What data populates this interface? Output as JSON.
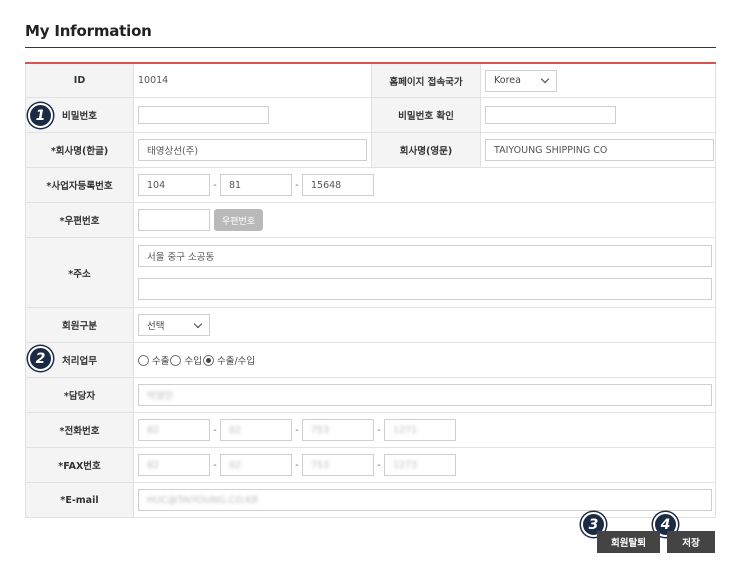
{
  "page": {
    "title": "My Information"
  },
  "form": {
    "id": {
      "label": "ID",
      "value": "10014"
    },
    "country": {
      "label": "홈페이지 접속국가",
      "selected": "Korea"
    },
    "password": {
      "label": "비밀번호",
      "value": ""
    },
    "password_confirm": {
      "label": "비밀번호 확인",
      "value": ""
    },
    "company_kr": {
      "label": "*회사명(한글)",
      "value": "태영상선(주)"
    },
    "company_en": {
      "label": "회사명(영문)",
      "value": "TAIYOUNG SHIPPING CO"
    },
    "business_no": {
      "label": "*사업자등록번호",
      "part1": "104",
      "part2": "81",
      "part3": "15648"
    },
    "postal": {
      "label": "*우편번호",
      "value": "",
      "button": "우편번호"
    },
    "address": {
      "label": "*주소",
      "line1": "서울 중구 소공동",
      "line2": ""
    },
    "member_type": {
      "label": "회원구분",
      "selected": "선택"
    },
    "business": {
      "label": "처리업무",
      "options": [
        {
          "label": "수출",
          "checked": false
        },
        {
          "label": "수입",
          "checked": false
        },
        {
          "label": "수출/수입",
          "checked": true
        }
      ]
    },
    "manager": {
      "label": "*담당자",
      "value": "박영민"
    },
    "phone": {
      "label": "*전화번호",
      "part1": "82",
      "part2": "02",
      "part3": "753",
      "part4": "1271"
    },
    "fax": {
      "label": "*FAX번호",
      "part1": "82",
      "part2": "02",
      "part3": "753",
      "part4": "1273"
    },
    "email": {
      "label": "*E-mail",
      "value": "HUC@TAIYOUNG.CO.KR"
    }
  },
  "badges": {
    "b1": "1",
    "b2": "2",
    "b3": "3",
    "b4": "4"
  },
  "buttons": {
    "withdraw": "회원탈퇴",
    "save": "저장"
  }
}
